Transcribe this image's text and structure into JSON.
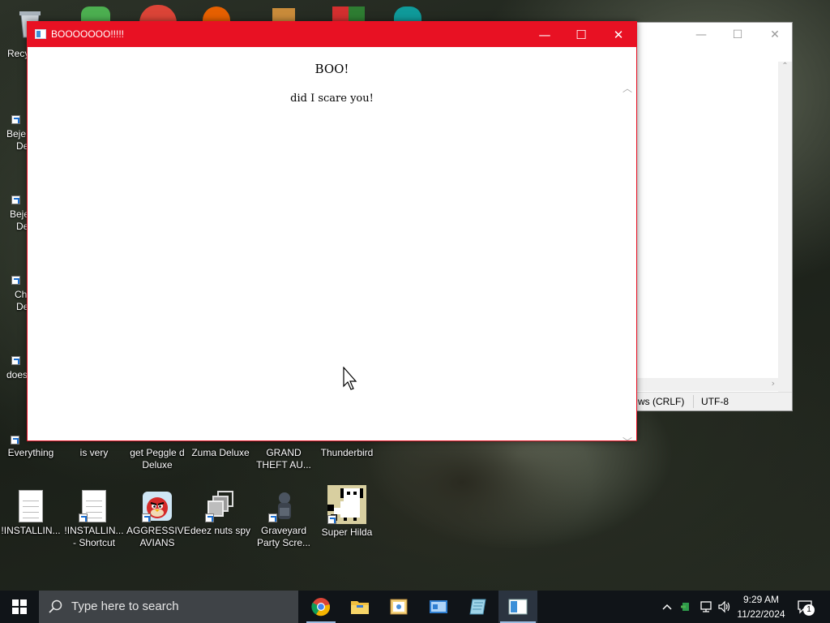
{
  "popup": {
    "title": "BOOOOOOO!!!!!",
    "heading": "BOO!",
    "message": "did I scare you!",
    "minimize_glyph": "—",
    "maximize_glyph": "☐",
    "close_glyph": "✕"
  },
  "notepad": {
    "line_ending": "ws (CRLF)",
    "encoding": "UTF-8"
  },
  "desktop": {
    "left_partial_labels": [
      "Recy",
      "Beje",
      "De",
      "Beje",
      "De",
      "Ch",
      "De",
      "does"
    ],
    "row1": [
      {
        "label": "Everything"
      },
      {
        "label": "is very"
      },
      {
        "label": "get Peggle d Deluxe"
      },
      {
        "label": "Zuma Deluxe"
      },
      {
        "label": "GRAND THEFT AU..."
      },
      {
        "label": "Thunderbird"
      }
    ],
    "row2": [
      {
        "label": "!INSTALLIN...",
        "icon": "document-icon"
      },
      {
        "label": "!INSTALLIN... - Shortcut",
        "icon": "document-shortcut-icon"
      },
      {
        "label": "AGGRESSIVE AVIANS",
        "icon": "angry-bird-icon"
      },
      {
        "label": "deez nuts spy",
        "icon": "windows-stack-icon"
      },
      {
        "label": "Graveyard Party Scre...",
        "icon": "graveyard-icon"
      },
      {
        "label": "Super Hilda",
        "icon": "pixel-dog-icon"
      }
    ]
  },
  "taskbar": {
    "search_placeholder": "Type here to search",
    "apps": [
      "chrome-icon",
      "file-explorer-icon",
      "photo-viewer-icon",
      "control-panel-icon",
      "notepad-icon",
      "popup-app-icon"
    ],
    "clock_time": "9:29 AM",
    "clock_date": "11/22/2024",
    "notification_count": "1"
  }
}
